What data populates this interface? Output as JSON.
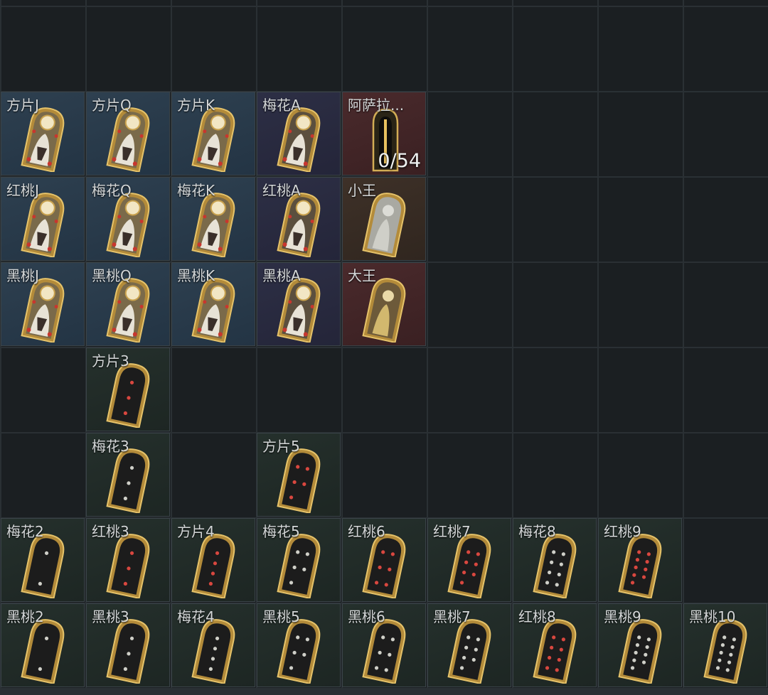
{
  "inventory": {
    "cells": [
      {
        "row": 0,
        "col": 0,
        "name": "方片J",
        "kind": "face",
        "icon": "face-card-icon"
      },
      {
        "row": 0,
        "col": 1,
        "name": "方片Q",
        "kind": "face",
        "icon": "face-card-icon"
      },
      {
        "row": 0,
        "col": 2,
        "name": "方片K",
        "kind": "face",
        "icon": "face-card-icon"
      },
      {
        "row": 0,
        "col": 3,
        "name": "梅花A",
        "kind": "ace",
        "icon": "ace-card-icon"
      },
      {
        "row": 0,
        "col": 4,
        "name": "阿萨拉...",
        "kind": "red",
        "icon": "card-case-icon",
        "count": "0/54"
      },
      {
        "row": 1,
        "col": 0,
        "name": "红桃J",
        "kind": "face",
        "icon": "face-card-icon"
      },
      {
        "row": 1,
        "col": 1,
        "name": "梅花Q",
        "kind": "face",
        "icon": "face-card-icon"
      },
      {
        "row": 1,
        "col": 2,
        "name": "梅花K",
        "kind": "face",
        "icon": "face-card-icon"
      },
      {
        "row": 1,
        "col": 3,
        "name": "红桃A",
        "kind": "ace",
        "icon": "ace-card-icon"
      },
      {
        "row": 1,
        "col": 4,
        "name": "小王",
        "kind": "brown",
        "icon": "little-joker-card-icon"
      },
      {
        "row": 2,
        "col": 0,
        "name": "黑桃J",
        "kind": "face",
        "icon": "face-card-icon"
      },
      {
        "row": 2,
        "col": 1,
        "name": "黑桃Q",
        "kind": "face",
        "icon": "face-card-icon"
      },
      {
        "row": 2,
        "col": 2,
        "name": "黑桃K",
        "kind": "face",
        "icon": "face-card-icon"
      },
      {
        "row": 2,
        "col": 3,
        "name": "黑桃A",
        "kind": "ace",
        "icon": "ace-card-icon"
      },
      {
        "row": 2,
        "col": 4,
        "name": "大王",
        "kind": "red",
        "icon": "big-joker-card-icon"
      },
      {
        "row": 3,
        "col": 1,
        "name": "方片3",
        "kind": "pip",
        "icon": "number-card-icon",
        "pips": 3,
        "pipColor": "#d9473f"
      },
      {
        "row": 4,
        "col": 1,
        "name": "梅花3",
        "kind": "pip",
        "icon": "number-card-icon",
        "pips": 3,
        "pipColor": "#cfcfc8"
      },
      {
        "row": 4,
        "col": 3,
        "name": "方片5",
        "kind": "pip",
        "icon": "number-card-icon",
        "pips": 5,
        "pipColor": "#d9473f"
      },
      {
        "row": 5,
        "col": 0,
        "name": "梅花2",
        "kind": "pip",
        "icon": "number-card-icon",
        "pips": 2,
        "pipColor": "#cfcfc8"
      },
      {
        "row": 5,
        "col": 1,
        "name": "红桃3",
        "kind": "pip",
        "icon": "number-card-icon",
        "pips": 3,
        "pipColor": "#d9473f"
      },
      {
        "row": 5,
        "col": 2,
        "name": "方片4",
        "kind": "pip",
        "icon": "number-card-icon",
        "pips": 4,
        "pipColor": "#d9473f"
      },
      {
        "row": 5,
        "col": 3,
        "name": "梅花5",
        "kind": "pip",
        "icon": "number-card-icon",
        "pips": 5,
        "pipColor": "#cfcfc8"
      },
      {
        "row": 5,
        "col": 4,
        "name": "红桃6",
        "kind": "pip",
        "icon": "number-card-icon",
        "pips": 6,
        "pipColor": "#d9473f"
      },
      {
        "row": 5,
        "col": 5,
        "name": "红桃7",
        "kind": "pip",
        "icon": "number-card-icon",
        "pips": 7,
        "pipColor": "#d9473f"
      },
      {
        "row": 5,
        "col": 6,
        "name": "梅花8",
        "kind": "pip",
        "icon": "number-card-icon",
        "pips": 8,
        "pipColor": "#cfcfc8"
      },
      {
        "row": 5,
        "col": 7,
        "name": "红桃9",
        "kind": "pip",
        "icon": "number-card-icon",
        "pips": 9,
        "pipColor": "#d9473f"
      },
      {
        "row": 6,
        "col": 0,
        "name": "黑桃2",
        "kind": "pip",
        "icon": "number-card-icon",
        "pips": 2,
        "pipColor": "#cfcfc8"
      },
      {
        "row": 6,
        "col": 1,
        "name": "黑桃3",
        "kind": "pip",
        "icon": "number-card-icon",
        "pips": 3,
        "pipColor": "#cfcfc8"
      },
      {
        "row": 6,
        "col": 2,
        "name": "梅花4",
        "kind": "pip",
        "icon": "number-card-icon",
        "pips": 4,
        "pipColor": "#cfcfc8"
      },
      {
        "row": 6,
        "col": 3,
        "name": "黑桃5",
        "kind": "pip",
        "icon": "number-card-icon",
        "pips": 5,
        "pipColor": "#cfcfc8"
      },
      {
        "row": 6,
        "col": 4,
        "name": "黑桃6",
        "kind": "pip",
        "icon": "number-card-icon",
        "pips": 6,
        "pipColor": "#cfcfc8"
      },
      {
        "row": 6,
        "col": 5,
        "name": "黑桃7",
        "kind": "pip",
        "icon": "number-card-icon",
        "pips": 7,
        "pipColor": "#cfcfc8"
      },
      {
        "row": 6,
        "col": 6,
        "name": "红桃8",
        "kind": "pip",
        "icon": "number-card-icon",
        "pips": 8,
        "pipColor": "#d9473f"
      },
      {
        "row": 6,
        "col": 7,
        "name": "黑桃9",
        "kind": "pip",
        "icon": "number-card-icon",
        "pips": 9,
        "pipColor": "#cfcfc8"
      },
      {
        "row": 6,
        "col": 8,
        "name": "黑桃10",
        "kind": "pip",
        "icon": "number-card-icon",
        "pips": 10,
        "pipColor": "#cfcfc8"
      }
    ]
  }
}
